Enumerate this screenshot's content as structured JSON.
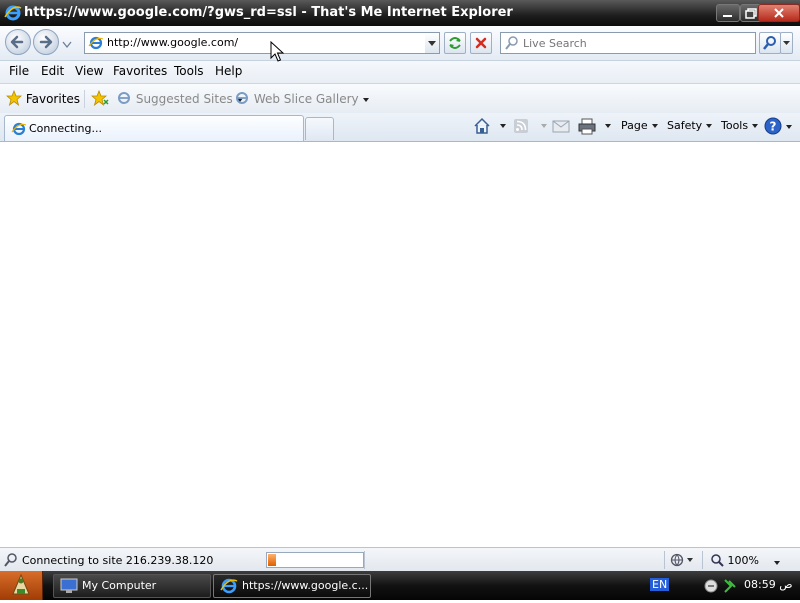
{
  "window": {
    "title": "https://www.google.com/?gws_rd=ssl - That's Me Internet Explorer"
  },
  "address_bar": {
    "url": "http://www.google.com/"
  },
  "search": {
    "placeholder": "Live Search"
  },
  "menu": {
    "items": [
      "File",
      "Edit",
      "View",
      "Favorites",
      "Tools",
      "Help"
    ]
  },
  "favorites_bar": {
    "favorites_label": "Favorites",
    "suggested_sites": "Suggested Sites",
    "web_slice_gallery": "Web Slice Gallery"
  },
  "tabs": {
    "active_tab_label": "Connecting..."
  },
  "command_bar": {
    "page": "Page",
    "safety": "Safety",
    "tools": "Tools"
  },
  "status_bar": {
    "text": "Connecting to site 216.239.38.120",
    "progress": 0.08,
    "zoom": "100%"
  },
  "taskbar": {
    "tasks": [
      "My Computer",
      "https://www.google.c..."
    ],
    "language": "EN",
    "clock": "08:59 ص"
  },
  "colors": {
    "titlebar": "#1d1d1d",
    "close_button": "#c0392b",
    "start_button": "#c8561a",
    "progress_fill": "#f07a1a"
  },
  "icons": [
    "ie-icon",
    "back-arrow-icon",
    "forward-arrow-icon",
    "refresh-icon",
    "stop-icon",
    "search-icon",
    "star-icon",
    "home-icon",
    "rss-icon",
    "mail-icon",
    "print-icon",
    "help-icon",
    "magnifier-icon",
    "globe-icon"
  ]
}
